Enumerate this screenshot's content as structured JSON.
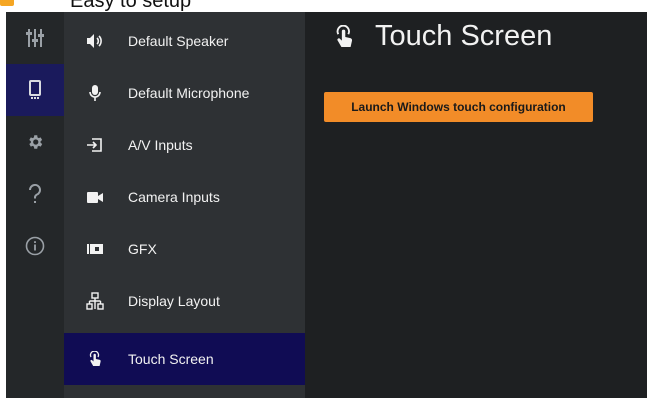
{
  "window": {
    "title": "Easy to setup"
  },
  "iconbar": {
    "items": [
      {
        "icon": "mixer-sliders-icon"
      },
      {
        "icon": "device-icon",
        "active": true
      },
      {
        "icon": "gear-icon"
      },
      {
        "icon": "question-icon"
      },
      {
        "icon": "info-icon"
      }
    ]
  },
  "nav": {
    "items": [
      {
        "label": "Default Speaker",
        "icon": "speaker-icon"
      },
      {
        "label": "Default Microphone",
        "icon": "microphone-icon"
      },
      {
        "label": "A/V Inputs",
        "icon": "input-icon"
      },
      {
        "label": "Camera Inputs",
        "icon": "camera-icon"
      },
      {
        "label": "GFX",
        "icon": "gfx-icon"
      },
      {
        "label": "Display Layout",
        "icon": "display-layout-icon"
      },
      {
        "label": "Touch Screen",
        "icon": "touch-icon",
        "active": true
      }
    ]
  },
  "main": {
    "title": "Touch Screen",
    "launch_button_label": "Launch Windows touch configuration"
  },
  "colors": {
    "accent_orange": "#f28c28",
    "active_nav": "#100c54",
    "background": "#1e2022"
  }
}
